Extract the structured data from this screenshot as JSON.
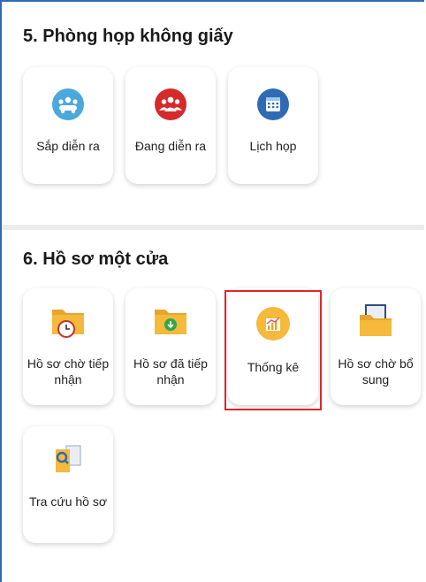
{
  "section5": {
    "title": "5. Phòng họp không giấy",
    "tiles": [
      {
        "label": "Sắp diễn ra",
        "icon": "people-meeting-icon",
        "color": "#4aa8dc"
      },
      {
        "label": "Đang diễn ra",
        "icon": "group-people-icon",
        "color": "#d42a2a"
      },
      {
        "label": "Lịch họp",
        "icon": "calendar-icon",
        "color": "#2f6bb5"
      }
    ]
  },
  "section6": {
    "title": "6. Hồ sơ một cửa",
    "tiles": [
      {
        "label": "Hồ sơ chờ tiếp nhận",
        "icon": "folder-clock-icon",
        "color": "#f5b93c"
      },
      {
        "label": "Hồ sơ đã tiếp nhận",
        "icon": "folder-download-icon",
        "color": "#f5b93c"
      },
      {
        "label": "Thống kê",
        "icon": "chart-icon",
        "color": "#f5b93c"
      },
      {
        "label": "Hồ sơ chờ bổ sung",
        "icon": "folder-document-icon",
        "color": "#f5b93c"
      },
      {
        "label": "Tra cứu hồ sơ",
        "icon": "search-document-icon",
        "color": "#f5b93c"
      }
    ]
  },
  "highlight_color": "#e0252b"
}
